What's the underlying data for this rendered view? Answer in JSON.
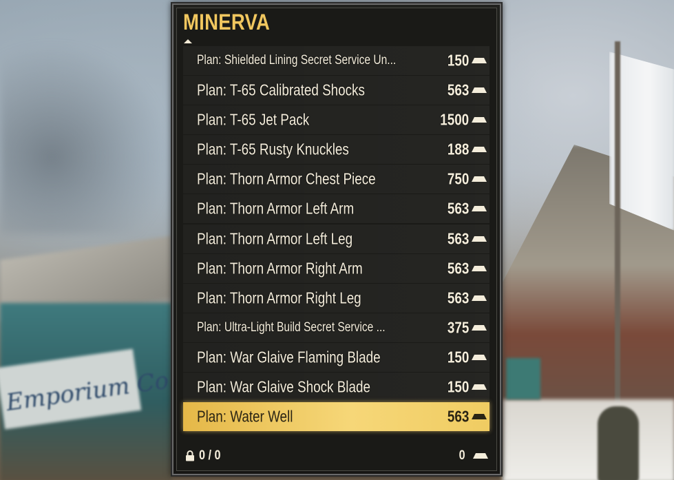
{
  "vendor": {
    "title": "MINERVA"
  },
  "items": [
    {
      "name": "Plan: Shielded Lining Secret Service Un...",
      "price": "150",
      "small": true,
      "selected": false
    },
    {
      "name": "Plan: T-65 Calibrated Shocks",
      "price": "563",
      "small": false,
      "selected": false
    },
    {
      "name": "Plan: T-65 Jet Pack",
      "price": "1500",
      "small": false,
      "selected": false
    },
    {
      "name": "Plan: T-65 Rusty Knuckles",
      "price": "188",
      "small": false,
      "selected": false
    },
    {
      "name": "Plan: Thorn Armor Chest Piece",
      "price": "750",
      "small": false,
      "selected": false
    },
    {
      "name": "Plan: Thorn Armor Left Arm",
      "price": "563",
      "small": false,
      "selected": false
    },
    {
      "name": "Plan: Thorn Armor Left Leg",
      "price": "563",
      "small": false,
      "selected": false
    },
    {
      "name": "Plan: Thorn Armor Right Arm",
      "price": "563",
      "small": false,
      "selected": false
    },
    {
      "name": "Plan: Thorn Armor Right Leg",
      "price": "563",
      "small": false,
      "selected": false
    },
    {
      "name": "Plan: Ultra-Light Build Secret Service ...",
      "price": "375",
      "small": true,
      "selected": false
    },
    {
      "name": "Plan: War Glaive Flaming Blade",
      "price": "150",
      "small": false,
      "selected": false
    },
    {
      "name": "Plan: War Glaive Shock Blade",
      "price": "150",
      "small": false,
      "selected": false
    },
    {
      "name": "Plan: Water Well",
      "price": "563",
      "small": false,
      "selected": true
    }
  ],
  "footer": {
    "capacity": "0 / 0",
    "total": "0"
  },
  "background": {
    "sign_text": "Emporium Co."
  },
  "icons": {
    "currency": "gold-bullion-icon",
    "lock": "lock-icon",
    "scroll": "scroll-up-arrow-icon"
  },
  "colors": {
    "title": "#f1c75f",
    "text": "#f4eddb",
    "selected_bg": "#f0cc62",
    "selected_text": "#2a2414",
    "panel_bg": "#1a1a17"
  }
}
